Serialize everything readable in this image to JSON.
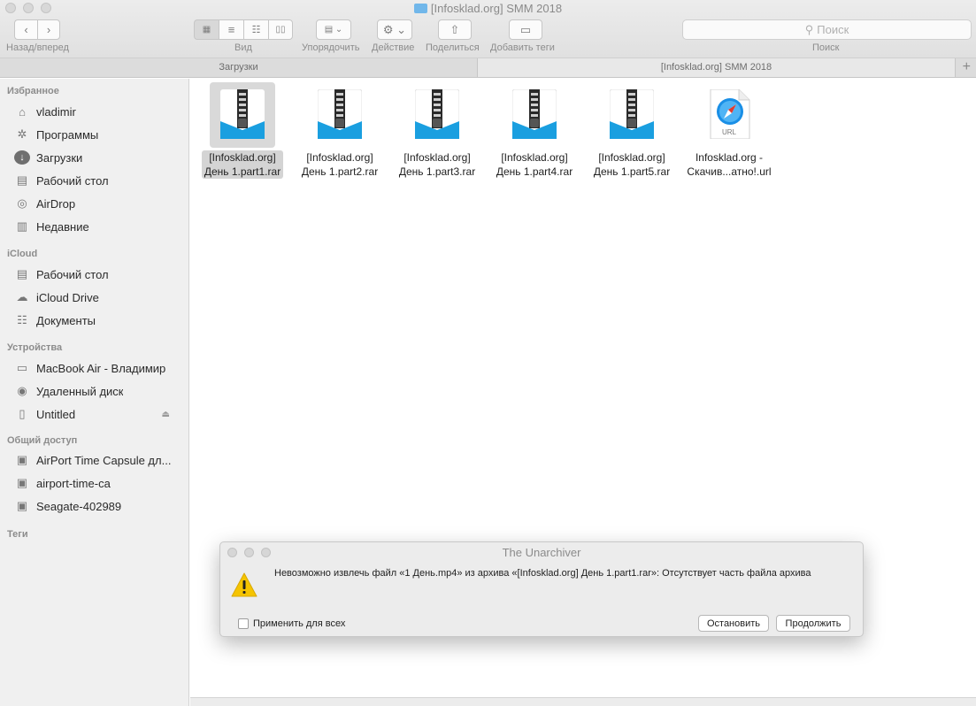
{
  "window": {
    "title": "[Infosklad.org] SMM 2018"
  },
  "toolbar": {
    "nav_label": "Назад/вперед",
    "view_label": "Вид",
    "arrange_label": "Упорядочить",
    "action_label": "Действие",
    "share_label": "Поделиться",
    "tags_label": "Добавить теги",
    "search_placeholder": "Поиск",
    "search_label": "Поиск"
  },
  "tabs": [
    {
      "label": "Загрузки"
    },
    {
      "label": "[Infosklad.org] SMM 2018"
    }
  ],
  "sidebar": {
    "favorites_header": "Избранное",
    "favorites": [
      {
        "label": "vladimir",
        "icon": "home-icon"
      },
      {
        "label": "Программы",
        "icon": "apps-icon"
      },
      {
        "label": "Загрузки",
        "icon": "downloads-icon"
      },
      {
        "label": "Рабочий стол",
        "icon": "desktop-icon"
      },
      {
        "label": "AirDrop",
        "icon": "airdrop-icon"
      },
      {
        "label": "Недавние",
        "icon": "recents-icon"
      }
    ],
    "icloud_header": "iCloud",
    "icloud": [
      {
        "label": "Рабочий стол",
        "icon": "desktop-icon"
      },
      {
        "label": "iCloud Drive",
        "icon": "cloud-icon"
      },
      {
        "label": "Документы",
        "icon": "documents-icon"
      }
    ],
    "devices_header": "Устройства",
    "devices": [
      {
        "label": "MacBook Air - Владимир",
        "icon": "laptop-icon"
      },
      {
        "label": "Удаленный диск",
        "icon": "disc-icon"
      },
      {
        "label": "Untitled",
        "icon": "drive-icon"
      }
    ],
    "shared_header": "Общий доступ",
    "shared": [
      {
        "label": "AirPort Time Capsule дл...",
        "icon": "monitor-icon"
      },
      {
        "label": "airport-time-ca",
        "icon": "monitor-icon"
      },
      {
        "label": "Seagate-402989",
        "icon": "monitor-icon"
      }
    ],
    "tags_header": "Теги"
  },
  "files": [
    {
      "line1": "[Infosklad.org]",
      "line2": "День 1.part1.rar",
      "selected": true
    },
    {
      "line1": "[Infosklad.org]",
      "line2": "День 1.part2.rar"
    },
    {
      "line1": "[Infosklad.org]",
      "line2": "День 1.part3.rar"
    },
    {
      "line1": "[Infosklad.org]",
      "line2": "День 1.part4.rar"
    },
    {
      "line1": "[Infosklad.org]",
      "line2": "День 1.part5.rar"
    },
    {
      "line1": "Infosklad.org -",
      "line2": "Скачив...атно!.url",
      "icon_text": "URL"
    }
  ],
  "dialog": {
    "title": "The Unarchiver",
    "message": "Невозможно извлечь файл «1 День.mp4» из архива «[Infosklad.org] День 1.part1.rar»: Отсутствует часть файла архива",
    "checkbox_label": "Применить для всех",
    "stop_button": "Остановить",
    "continue_button": "Продолжить"
  },
  "colors": {
    "accent_blue": "#1a9fe0",
    "warning_yellow": "#f5c400"
  }
}
